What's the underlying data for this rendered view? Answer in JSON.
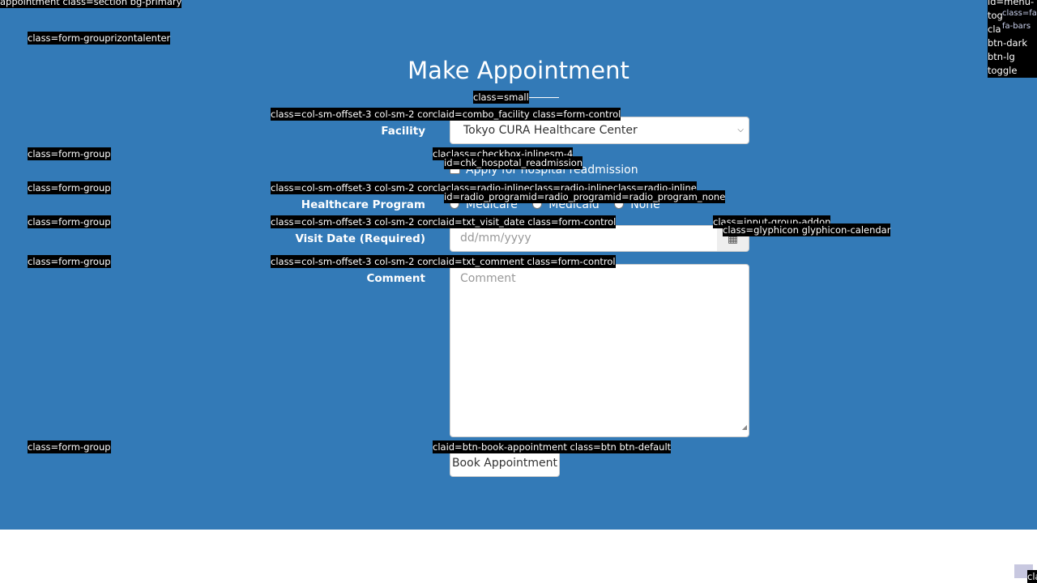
{
  "page": {
    "title": "Make Appointment"
  },
  "form": {
    "facility_label": "Facility",
    "facility_value": "Tokyo CURA Healthcare Center",
    "readmission_label": "Apply for hospital readmission",
    "program_label": "Healthcare Program",
    "programs": [
      "Medicare",
      "Medicaid",
      "None"
    ],
    "visit_date_label": "Visit Date (Required)",
    "visit_date_placeholder": "dd/mm/yyyy",
    "comment_label": "Comment",
    "comment_placeholder": "Comment",
    "submit_label": "Book Appointment"
  },
  "debug_labels": {
    "section": "appointment class=section bg-primary",
    "form_group_horizontal": "class=form-grouprizontalenter",
    "small": "class=small",
    "facility_col": "class=col-sm-offset-3 col-sm-2 control-la",
    "facility_combo": "claid=combo_facility class=form-control",
    "form_group_1": "class=form-group",
    "checkbox_inline": "claclass=checkbox-inlinesm-4",
    "chk_id": "id=chk_hospotal_readmission",
    "form_group_2": "class=form-group",
    "program_col": "class=col-sm-offset-3 col-sm-2 control-la",
    "radio_inline": "claclass=radio-inlineclass=radio-inlineclass=radio-inline",
    "radio_ids": "id=radio_programid=radio_programid=radio_program_none",
    "form_group_3": "class=form-group",
    "visit_col": "class=col-sm-offset-3 col-sm-2 control-la",
    "visit_input": "claid=txt_visit_date class=form-control",
    "input_addon": "class=input-group-addon",
    "glyph": "class=glyphicon glyphicon-calendar",
    "form_group_4": "class=form-group",
    "comment_col": "class=col-sm-offset-3 col-sm-2 control-la",
    "comment_input": "claid=txt_comment class=form-control",
    "form_group_5": "class=form-group",
    "book_button": "claid=btn-book-appointment class=btn btn-default",
    "menu_classes": [
      "id=menu-",
      "tog",
      "cla",
      "btn-dark",
      "btn-lg",
      "toggle"
    ],
    "fa_class": "class=fa",
    "fa_bars": "fa-bars",
    "corner_tag": "cla"
  },
  "icons": {
    "menu": "bars-icon",
    "calendar": "calendar-icon",
    "dropdown": "chevron-down-icon"
  },
  "colors": {
    "section_bg": "#337ab7",
    "debug_bg": "#000000"
  }
}
